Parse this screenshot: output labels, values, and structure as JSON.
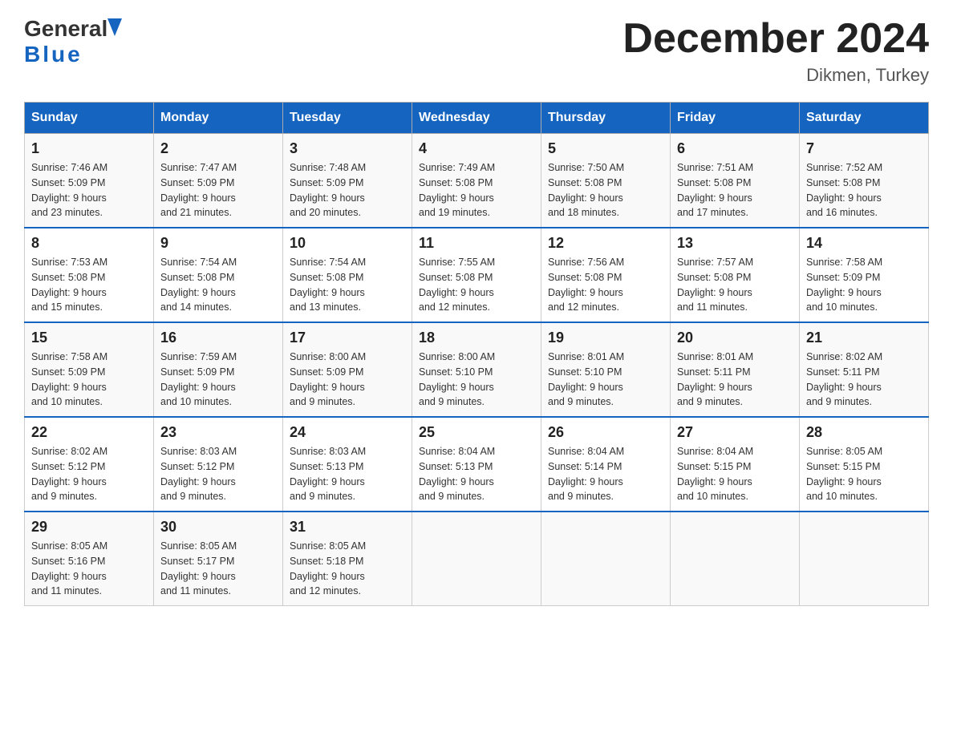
{
  "logo": {
    "general": "General",
    "blue": "Blue",
    "tagline": "Blue"
  },
  "header": {
    "title": "December 2024",
    "location": "Dikmen, Turkey"
  },
  "days_of_week": [
    "Sunday",
    "Monday",
    "Tuesday",
    "Wednesday",
    "Thursday",
    "Friday",
    "Saturday"
  ],
  "weeks": [
    [
      {
        "day": "1",
        "sunrise": "7:46 AM",
        "sunset": "5:09 PM",
        "daylight": "9 hours and 23 minutes."
      },
      {
        "day": "2",
        "sunrise": "7:47 AM",
        "sunset": "5:09 PM",
        "daylight": "9 hours and 21 minutes."
      },
      {
        "day": "3",
        "sunrise": "7:48 AM",
        "sunset": "5:09 PM",
        "daylight": "9 hours and 20 minutes."
      },
      {
        "day": "4",
        "sunrise": "7:49 AM",
        "sunset": "5:08 PM",
        "daylight": "9 hours and 19 minutes."
      },
      {
        "day": "5",
        "sunrise": "7:50 AM",
        "sunset": "5:08 PM",
        "daylight": "9 hours and 18 minutes."
      },
      {
        "day": "6",
        "sunrise": "7:51 AM",
        "sunset": "5:08 PM",
        "daylight": "9 hours and 17 minutes."
      },
      {
        "day": "7",
        "sunrise": "7:52 AM",
        "sunset": "5:08 PM",
        "daylight": "9 hours and 16 minutes."
      }
    ],
    [
      {
        "day": "8",
        "sunrise": "7:53 AM",
        "sunset": "5:08 PM",
        "daylight": "9 hours and 15 minutes."
      },
      {
        "day": "9",
        "sunrise": "7:54 AM",
        "sunset": "5:08 PM",
        "daylight": "9 hours and 14 minutes."
      },
      {
        "day": "10",
        "sunrise": "7:54 AM",
        "sunset": "5:08 PM",
        "daylight": "9 hours and 13 minutes."
      },
      {
        "day": "11",
        "sunrise": "7:55 AM",
        "sunset": "5:08 PM",
        "daylight": "9 hours and 12 minutes."
      },
      {
        "day": "12",
        "sunrise": "7:56 AM",
        "sunset": "5:08 PM",
        "daylight": "9 hours and 12 minutes."
      },
      {
        "day": "13",
        "sunrise": "7:57 AM",
        "sunset": "5:08 PM",
        "daylight": "9 hours and 11 minutes."
      },
      {
        "day": "14",
        "sunrise": "7:58 AM",
        "sunset": "5:09 PM",
        "daylight": "9 hours and 10 minutes."
      }
    ],
    [
      {
        "day": "15",
        "sunrise": "7:58 AM",
        "sunset": "5:09 PM",
        "daylight": "9 hours and 10 minutes."
      },
      {
        "day": "16",
        "sunrise": "7:59 AM",
        "sunset": "5:09 PM",
        "daylight": "9 hours and 10 minutes."
      },
      {
        "day": "17",
        "sunrise": "8:00 AM",
        "sunset": "5:09 PM",
        "daylight": "9 hours and 9 minutes."
      },
      {
        "day": "18",
        "sunrise": "8:00 AM",
        "sunset": "5:10 PM",
        "daylight": "9 hours and 9 minutes."
      },
      {
        "day": "19",
        "sunrise": "8:01 AM",
        "sunset": "5:10 PM",
        "daylight": "9 hours and 9 minutes."
      },
      {
        "day": "20",
        "sunrise": "8:01 AM",
        "sunset": "5:11 PM",
        "daylight": "9 hours and 9 minutes."
      },
      {
        "day": "21",
        "sunrise": "8:02 AM",
        "sunset": "5:11 PM",
        "daylight": "9 hours and 9 minutes."
      }
    ],
    [
      {
        "day": "22",
        "sunrise": "8:02 AM",
        "sunset": "5:12 PM",
        "daylight": "9 hours and 9 minutes."
      },
      {
        "day": "23",
        "sunrise": "8:03 AM",
        "sunset": "5:12 PM",
        "daylight": "9 hours and 9 minutes."
      },
      {
        "day": "24",
        "sunrise": "8:03 AM",
        "sunset": "5:13 PM",
        "daylight": "9 hours and 9 minutes."
      },
      {
        "day": "25",
        "sunrise": "8:04 AM",
        "sunset": "5:13 PM",
        "daylight": "9 hours and 9 minutes."
      },
      {
        "day": "26",
        "sunrise": "8:04 AM",
        "sunset": "5:14 PM",
        "daylight": "9 hours and 9 minutes."
      },
      {
        "day": "27",
        "sunrise": "8:04 AM",
        "sunset": "5:15 PM",
        "daylight": "9 hours and 10 minutes."
      },
      {
        "day": "28",
        "sunrise": "8:05 AM",
        "sunset": "5:15 PM",
        "daylight": "9 hours and 10 minutes."
      }
    ],
    [
      {
        "day": "29",
        "sunrise": "8:05 AM",
        "sunset": "5:16 PM",
        "daylight": "9 hours and 11 minutes."
      },
      {
        "day": "30",
        "sunrise": "8:05 AM",
        "sunset": "5:17 PM",
        "daylight": "9 hours and 11 minutes."
      },
      {
        "day": "31",
        "sunrise": "8:05 AM",
        "sunset": "5:18 PM",
        "daylight": "9 hours and 12 minutes."
      },
      null,
      null,
      null,
      null
    ]
  ],
  "labels": {
    "sunrise": "Sunrise:",
    "sunset": "Sunset:",
    "daylight": "Daylight:"
  }
}
